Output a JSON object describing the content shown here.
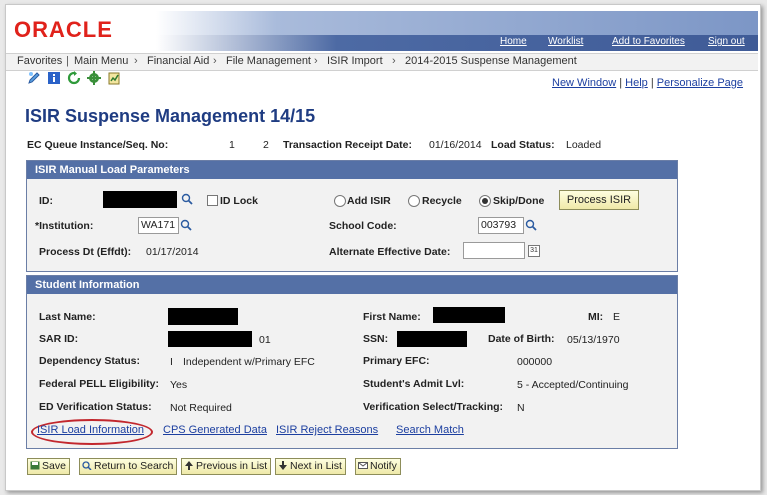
{
  "header": {
    "logo": "ORACLE",
    "links": [
      "Home",
      "Worklist",
      "Add to Favorites",
      "Sign out"
    ]
  },
  "breadcrumb": [
    "Favorites",
    "Main Menu",
    "Financial Aid",
    "File Management",
    "ISIR Import",
    "2014-2015 Suspense Management"
  ],
  "toolbar": {
    "icons": [
      "edit-icon",
      "info-icon",
      "refresh-icon",
      "gear-icon",
      "report-icon"
    ],
    "new_window": "New Window",
    "help": "Help",
    "personalize": "Personalize Page"
  },
  "page": {
    "title": "ISIR Suspense Management 14/15",
    "ec_queue_label": "EC Queue Instance/Seq. No:",
    "ec_queue_instance": "1",
    "ec_queue_seq": "2",
    "receipt_date_label": "Transaction Receipt Date:",
    "receipt_date": "01/16/2014",
    "load_status_label": "Load Status:",
    "load_status": "Loaded"
  },
  "manual_load": {
    "header": "ISIR Manual Load Parameters",
    "id_label": "ID:",
    "id_lock_label": "ID Lock",
    "add_isir": "Add ISIR",
    "recycle": "Recycle",
    "skip_done": "Skip/Done",
    "selected_action": "skip_done",
    "process_button": "Process ISIR",
    "institution_label": "*Institution:",
    "institution_value": "WA171",
    "school_code_label": "School Code:",
    "school_code_value": "003793",
    "process_dt_label": "Process Dt (Effdt):",
    "process_dt_value": "01/17/2014",
    "alt_eff_date_label": "Alternate Effective Date:",
    "alt_eff_date_value": "",
    "calendar_glyph": "31"
  },
  "student": {
    "header": "Student Information",
    "last_name_label": "Last Name:",
    "first_name_label": "First Name:",
    "mi_label": "MI:",
    "mi_value": "E",
    "sar_id_label": "SAR ID:",
    "sar_id_suffix": "01",
    "ssn_label": "SSN:",
    "dob_label": "Date of Birth:",
    "dob_value": "05/13/1970",
    "dependency_label": "Dependency Status:",
    "dependency_code": "I",
    "dependency_value": "Independent w/Primary EFC",
    "primary_efc_label": "Primary EFC:",
    "primary_efc_value": "000000",
    "pell_label": "Federal PELL Eligibility:",
    "pell_value": "Yes",
    "admit_lvl_label": "Student's Admit Lvl:",
    "admit_lvl_value": "5 - Accepted/Continuing",
    "ed_verif_label": "ED Verification Status:",
    "ed_verif_value": "Not Required",
    "verif_select_label": "Verification Select/Tracking:",
    "verif_select_value": "N"
  },
  "links": {
    "isir_load_info": "ISIR Load Information",
    "cps_data": "CPS Generated Data",
    "reject_reasons": "ISIR Reject Reasons",
    "search_match": "Search Match"
  },
  "bottom_buttons": {
    "save": "Save",
    "return_to_search": "Return to Search",
    "previous_in_list": "Previous in List",
    "next_in_list": "Next in List",
    "notify": "Notify"
  },
  "colors": {
    "oracle_red": "#e0221b",
    "header_blue": "#5470a6",
    "title_blue": "#1f3c82",
    "link_blue": "#1c3fa0",
    "highlight_red": "#c2272d"
  }
}
